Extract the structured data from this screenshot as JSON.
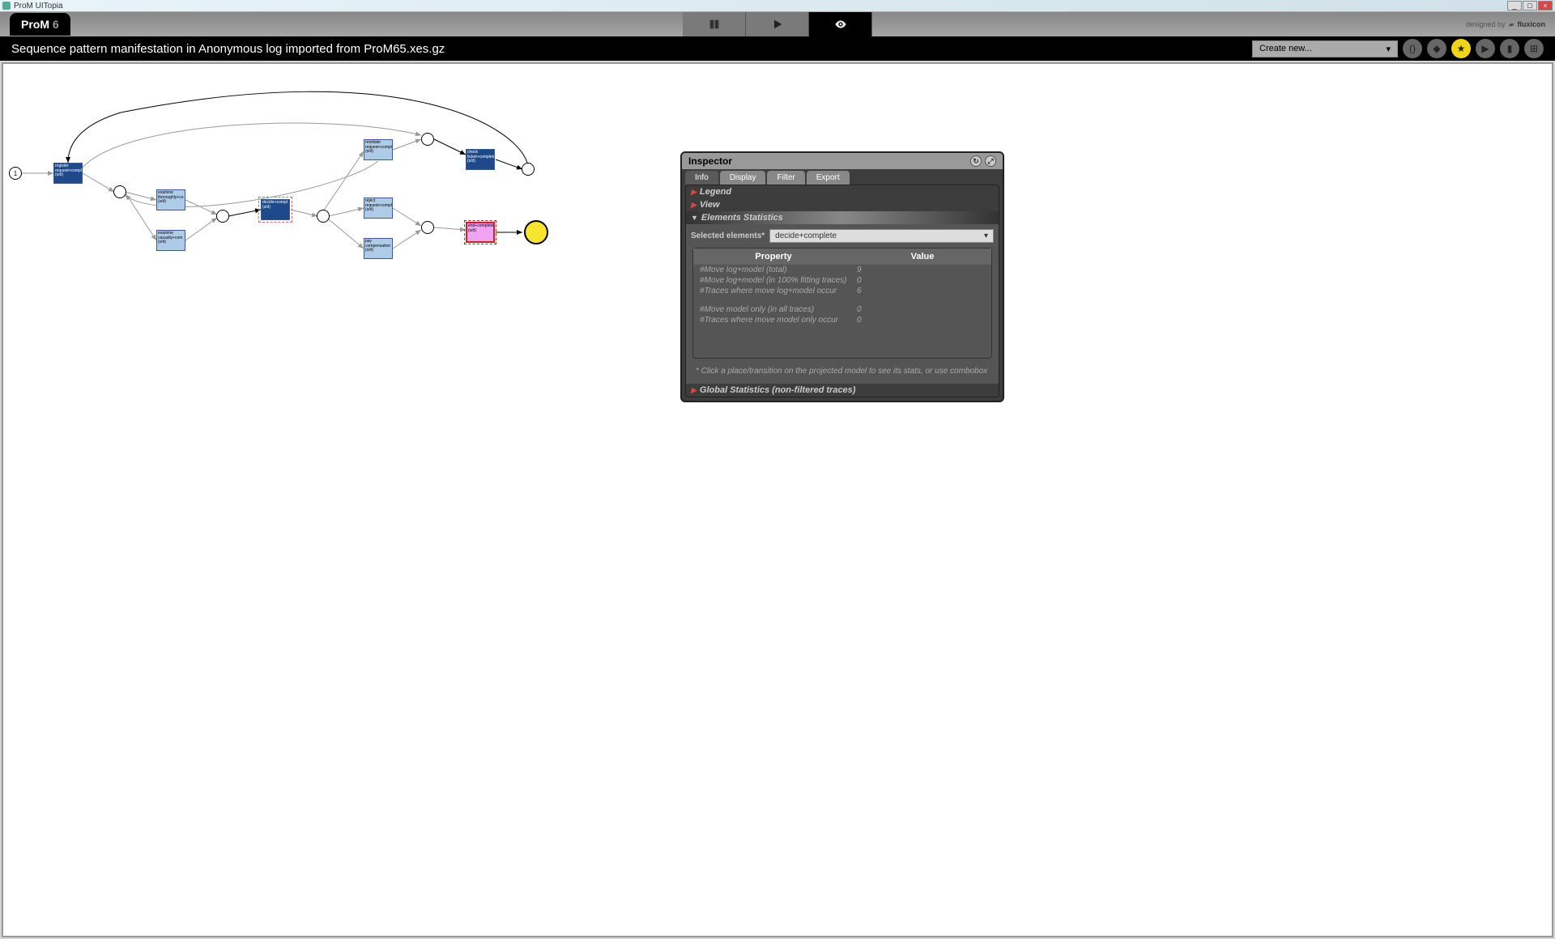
{
  "app": {
    "title": "ProM UITopia",
    "logo": "ProM",
    "logo_version": "6",
    "designed_by": "designed by",
    "fluxicon": "fluxicon"
  },
  "header": {
    "title": "Sequence pattern manifestation in Anonymous log imported from ProM65.xes.gz",
    "create_new": "Create new..."
  },
  "inspector": {
    "title": "Inspector",
    "tabs": {
      "info": "Info",
      "display": "Display",
      "filter": "Filter",
      "export": "Export"
    },
    "sections": {
      "legend": "Legend",
      "view": "View",
      "elem_stats": "Elements Statistics",
      "global_stats": "Global Statistics (non-filtered traces)"
    },
    "selected_label": "Selected elements*",
    "selected_value": "decide+complete",
    "table": {
      "h_property": "Property",
      "h_value": "Value",
      "rows": [
        {
          "p": "#Move log+model (total)",
          "v": "9"
        },
        {
          "p": "#Move log+model (in 100% fitting traces)",
          "v": "0"
        },
        {
          "p": "#Traces where move log+model occur",
          "v": "6"
        }
      ],
      "rows2": [
        {
          "p": "#Move model only (in all traces)",
          "v": "0"
        },
        {
          "p": "#Traces where move model only occur",
          "v": "0"
        }
      ]
    },
    "hint": "* Click a place/transition on the projected model to see its stats, or use combobox"
  },
  "petri": {
    "start_token": "1",
    "transitions": {
      "register": "register request+compl (s/d)",
      "examine_t": "examine thoroughly+co (s/d)",
      "examine_c": "examine casually+com (s/d)",
      "decide": "decide+compl (s/d)",
      "reinitiate": "reinitiate request+compl (s/d)",
      "reject": "reject request+compl (s/d)",
      "pay": "pay compensation (s/d)",
      "check": "check ticket+complete (s/d)",
      "end": "end+complete (s/d)"
    }
  }
}
